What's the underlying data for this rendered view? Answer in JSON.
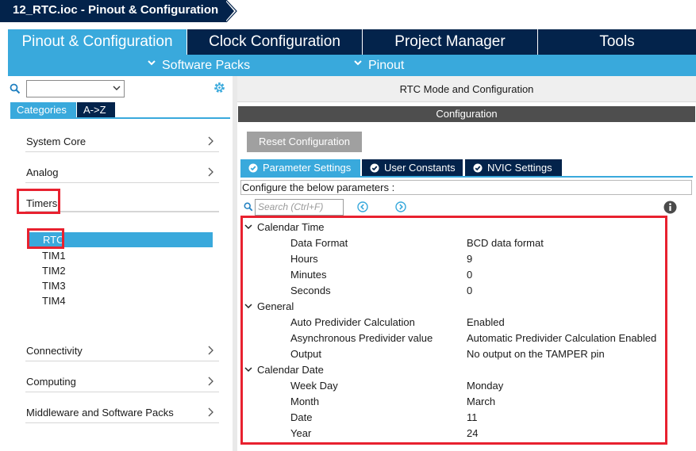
{
  "title": "12_RTC.ioc - Pinout & Configuration",
  "main_tabs": [
    "Pinout & Configuration",
    "Clock Configuration",
    "Project Manager",
    "Tools"
  ],
  "sub_menu": [
    "Software Packs",
    "Pinout"
  ],
  "left": {
    "tabs": [
      "Categories",
      "A->Z"
    ],
    "categories": {
      "system_core": "System Core",
      "analog": "Analog",
      "timers": "Timers",
      "connectivity": "Connectivity",
      "computing": "Computing",
      "middleware": "Middleware and Software Packs"
    },
    "timer_items": [
      "RTC",
      "TIM1",
      "TIM2",
      "TIM3",
      "TIM4"
    ]
  },
  "right": {
    "header": "RTC Mode and Configuration",
    "config_bar": "Configuration",
    "reset_button": "Reset Configuration",
    "tabs": [
      "Parameter Settings",
      "User Constants",
      "NVIC Settings"
    ],
    "instruction": "Configure the below parameters :",
    "search_placeholder": "Search (Ctrl+F)",
    "groups": [
      {
        "name": "Calendar Time",
        "params": [
          {
            "name": "Data Format",
            "value": "BCD data format"
          },
          {
            "name": "Hours",
            "value": "9"
          },
          {
            "name": "Minutes",
            "value": "0"
          },
          {
            "name": "Seconds",
            "value": "0"
          }
        ]
      },
      {
        "name": "General",
        "params": [
          {
            "name": "Auto Predivider Calculation",
            "value": "Enabled"
          },
          {
            "name": "Asynchronous Predivider value",
            "value": "Automatic Predivider Calculation Enabled"
          },
          {
            "name": "Output",
            "value": "No output on the TAMPER pin"
          }
        ]
      },
      {
        "name": "Calendar Date",
        "params": [
          {
            "name": "Week Day",
            "value": "Monday"
          },
          {
            "name": "Month",
            "value": "March"
          },
          {
            "name": "Date",
            "value": "11"
          },
          {
            "name": "Year",
            "value": "24"
          }
        ]
      }
    ]
  },
  "colors": {
    "navy": "#03234b",
    "accent": "#39a9dc",
    "highlight": "#e8212f"
  }
}
